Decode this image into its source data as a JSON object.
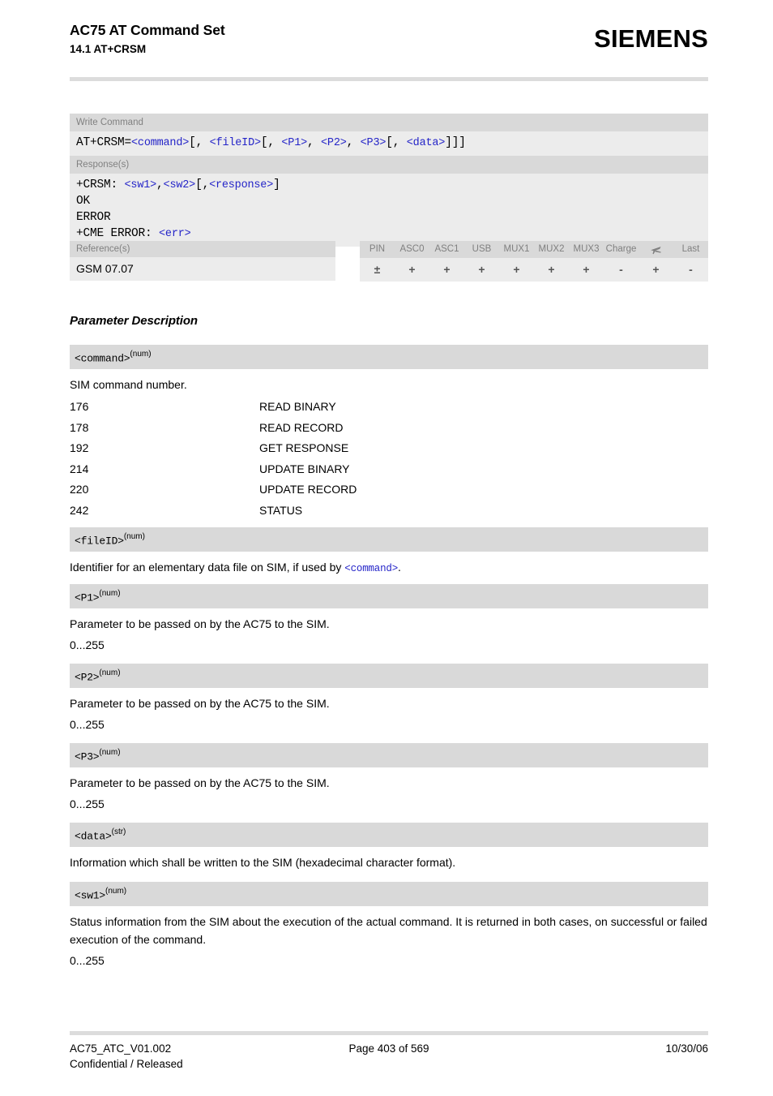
{
  "header": {
    "title": "AC75 AT Command Set",
    "subtitle": "14.1 AT+CRSM",
    "brand": "SIEMENS"
  },
  "syntax": {
    "write_command_label": "Write Command",
    "command_parts": [
      {
        "t": "AT+CRSM=",
        "k": "m"
      },
      {
        "t": "<command>",
        "k": "p"
      },
      {
        "t": "[, ",
        "k": "m"
      },
      {
        "t": "<fileID>",
        "k": "p"
      },
      {
        "t": "[, ",
        "k": "m"
      },
      {
        "t": "<P1>",
        "k": "p"
      },
      {
        "t": ", ",
        "k": "m"
      },
      {
        "t": "<P2>",
        "k": "p"
      },
      {
        "t": ", ",
        "k": "m"
      },
      {
        "t": "<P3>",
        "k": "p"
      },
      {
        "t": "[, ",
        "k": "m"
      },
      {
        "t": "<data>",
        "k": "p"
      },
      {
        "t": "]]]",
        "k": "m"
      }
    ],
    "responses_label": "Response(s)",
    "response_lines": [
      [
        {
          "t": "+CRSM: ",
          "k": "m"
        },
        {
          "t": "<sw1>",
          "k": "p"
        },
        {
          "t": ",",
          "k": "m"
        },
        {
          "t": "<sw2>",
          "k": "p"
        },
        {
          "t": "[,",
          "k": "m"
        },
        {
          "t": "<response>",
          "k": "p"
        },
        {
          "t": "]",
          "k": "m"
        }
      ],
      [
        {
          "t": "OK",
          "k": "m"
        }
      ],
      [
        {
          "t": "ERROR",
          "k": "m"
        }
      ],
      [
        {
          "t": "+CME ERROR: ",
          "k": "m"
        },
        {
          "t": "<err>",
          "k": "p"
        }
      ]
    ]
  },
  "reference": {
    "label": "Reference(s)",
    "value": "GSM 07.07"
  },
  "pin_table": {
    "columns": [
      "PIN",
      "ASC0",
      "ASC1",
      "USB",
      "MUX1",
      "MUX2",
      "MUX3",
      "Charge",
      "airplane-icon",
      "Last"
    ],
    "values": [
      "±",
      "+",
      "+",
      "+",
      "+",
      "+",
      "+",
      "-",
      "+",
      "-"
    ]
  },
  "section": {
    "heading": "Parameter Description"
  },
  "parameters": [
    {
      "name": "<command>",
      "type": "(num)",
      "intro": "SIM command number.",
      "table": [
        {
          "num": "176",
          "desc": "READ BINARY"
        },
        {
          "num": "178",
          "desc": "READ RECORD"
        },
        {
          "num": "192",
          "desc": "GET RESPONSE"
        },
        {
          "num": "214",
          "desc": "UPDATE BINARY"
        },
        {
          "num": "220",
          "desc": "UPDATE RECORD"
        },
        {
          "num": "242",
          "desc": "STATUS"
        }
      ]
    },
    {
      "name": "<fileID>",
      "type": "(num)",
      "desc_pre": "Identifier for an elementary data file on SIM, if used by ",
      "desc_code": "<command>",
      "desc_post": "."
    },
    {
      "name": "<P1>",
      "type": "(num)",
      "desc": "Parameter to be passed on by the AC75 to the SIM.",
      "range": "0...255"
    },
    {
      "name": "<P2>",
      "type": "(num)",
      "desc": "Parameter to be passed on by the AC75 to the SIM.",
      "range": "0...255"
    },
    {
      "name": "<P3>",
      "type": "(num)",
      "desc": "Parameter to be passed on by the AC75 to the SIM.",
      "range": "0...255"
    },
    {
      "name": "<data>",
      "type": "(str)",
      "desc": "Information which shall be written to the SIM (hexadecimal character format)."
    },
    {
      "name": "<sw1>",
      "type": "(num)",
      "desc": "Status information from the SIM about the execution of the actual command. It is returned in both cases, on successful or failed execution of the command.",
      "range": "0...255"
    }
  ],
  "footer": {
    "doc_id": "AC75_ATC_V01.002",
    "page": "Page 403 of 569",
    "date": "10/30/06",
    "classification": "Confidential / Released"
  }
}
